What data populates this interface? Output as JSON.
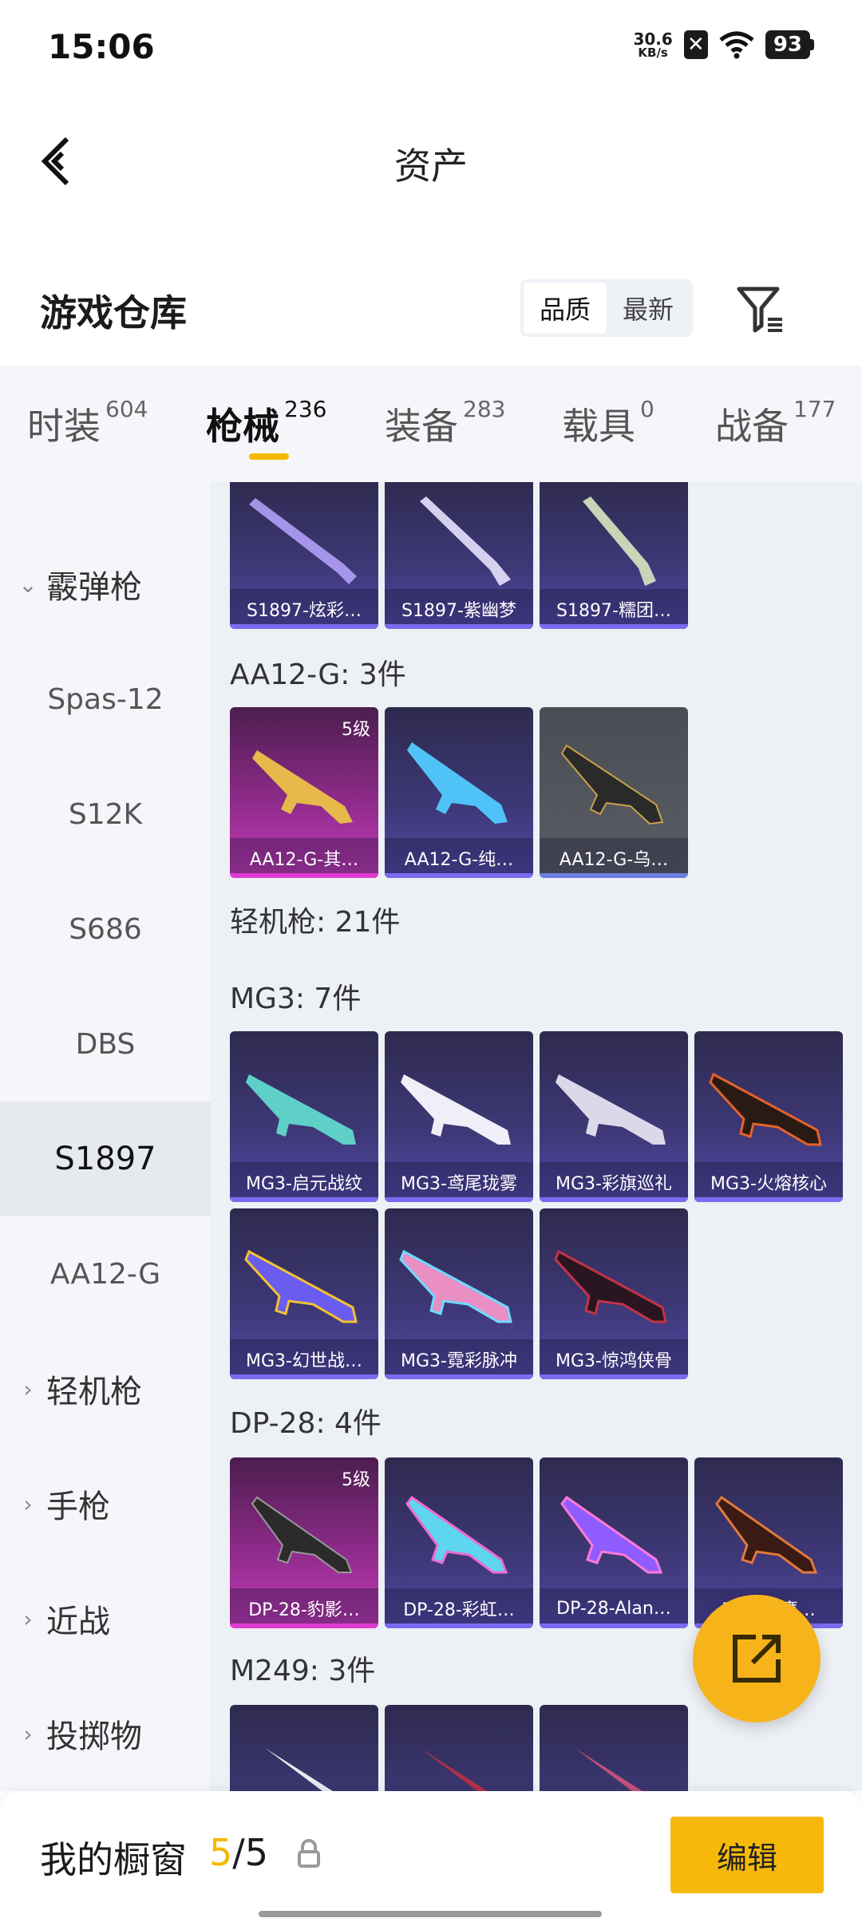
{
  "status": {
    "time": "15:06",
    "net_value": "30.6",
    "net_unit": "KB/s",
    "battery": "93"
  },
  "header": {
    "title": "资产"
  },
  "section": {
    "title": "游戏仓库",
    "sort_quality": "品质",
    "sort_latest": "最新"
  },
  "tabs": [
    {
      "label": "时装",
      "count": "604"
    },
    {
      "label": "枪械",
      "count": "236"
    },
    {
      "label": "装备",
      "count": "283"
    },
    {
      "label": "载具",
      "count": "0"
    },
    {
      "label": "战备",
      "count": "177"
    }
  ],
  "sidebar": {
    "group_shotgun": "霰弹枪",
    "items": [
      "Spas-12",
      "S12K",
      "S686",
      "DBS",
      "S1897",
      "AA12-G"
    ],
    "groups": [
      "轻机枪",
      "手枪",
      "近战",
      "投掷物"
    ]
  },
  "groups": {
    "s1897": {
      "cards": [
        "S1897-炫彩…",
        "S1897-紫幽梦",
        "S1897-糯团…"
      ]
    },
    "aa12": {
      "title": "AA12-G: 3件",
      "cards": [
        "AA12-G-其…",
        "AA12-G-纯…",
        "AA12-G-乌…"
      ],
      "level": "5级"
    },
    "lmg": {
      "title": "轻机枪: 21件"
    },
    "mg3": {
      "title": "MG3: 7件",
      "cards": [
        "MG3-启元战纹",
        "MG3-鸢尾珑雾",
        "MG3-彩旗巡礼",
        "MG3-火熔核心",
        "MG3-幻世战…",
        "MG3-霓彩脉冲",
        "MG3-惊鸿侠骨"
      ]
    },
    "dp28": {
      "title": "DP-28: 4件",
      "cards": [
        "DP-28-豹影…",
        "DP-28-彩虹…",
        "DP-28-Alan…",
        "DP-28-鹰…"
      ],
      "level": "5级"
    },
    "m249": {
      "title": "M249: 3件"
    }
  },
  "bottom": {
    "label": "我的橱窗",
    "count_current": "5",
    "count_sep": "/",
    "count_total": "5",
    "edit": "编辑"
  },
  "colors": {
    "accent": "#f5b800",
    "fab": "#f6b41a",
    "card_purple": "#3e3878",
    "card_gold": "#c63bb8"
  }
}
